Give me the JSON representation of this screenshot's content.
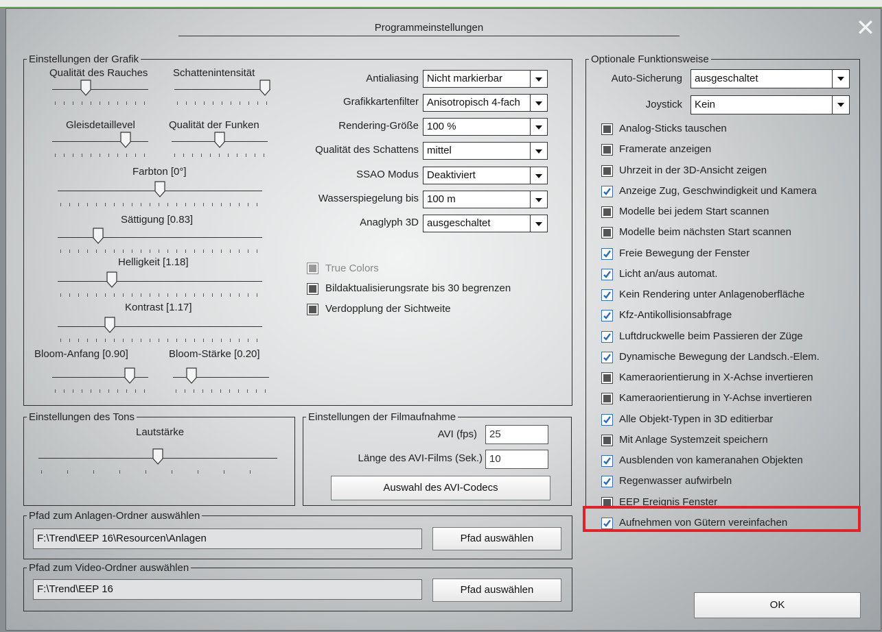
{
  "window": {
    "title": "Programmeinstellungen"
  },
  "graphics": {
    "legend": "Einstellungen der Grafik",
    "sliders": {
      "smoke": {
        "label": "Qualität des Rauches",
        "level": 0.33
      },
      "shadow": {
        "label": "Schattenintensität",
        "level": 1.0
      },
      "track_detail": {
        "label": "Gleisdetaillevel",
        "level": 0.8
      },
      "sparks": {
        "label": "Qualität der Funken",
        "level": 0.5
      },
      "hue": {
        "label": "Farbton [0°]",
        "level": 0.5
      },
      "saturation": {
        "label": "Sättigung [0.83]",
        "level": 0.18
      },
      "brightness": {
        "label": "Helligkeit [1.18]",
        "level": 0.25
      },
      "contrast": {
        "label": "Kontrast [1.17]",
        "level": 0.24
      },
      "bloom_start": {
        "label": "Bloom-Anfang [0.90]",
        "level": 0.85
      },
      "bloom_strength": {
        "label": "Bloom-Stärke [0.20]",
        "level": 0.15
      }
    },
    "combos": [
      {
        "label": "Antialiasing",
        "value": "Nicht markierbar"
      },
      {
        "label": "Grafikkartenfilter",
        "value": "Anisotropisch 4-fach"
      },
      {
        "label": "Rendering-Größe",
        "value": "100 %"
      },
      {
        "label": "Qualität des Schattens",
        "value": "mittel"
      },
      {
        "label": "SSAO Modus",
        "value": "Deaktiviert"
      },
      {
        "label": "Wasserspiegelung bis",
        "value": "100 m"
      },
      {
        "label": "Anaglyph 3D",
        "value": "ausgeschaltet"
      }
    ],
    "checks": [
      {
        "label": "True Colors",
        "state": "disabled"
      },
      {
        "label": "Bildaktualisierungsrate bis 30 begrenzen",
        "state": "off"
      },
      {
        "label": "Verdopplung der Sichtweite",
        "state": "off"
      }
    ]
  },
  "sound": {
    "legend": "Einstellungen des Tons",
    "volume_label": "Lautstärke",
    "volume_level": 0.5
  },
  "film": {
    "legend": "Einstellungen der Filmaufnahme",
    "avi_fps_label": "AVI (fps)",
    "avi_fps_value": "25",
    "avi_length_label": "Länge des AVI-Films (Sek.)",
    "avi_length_value": "10",
    "codec_button": "Auswahl des AVI-Codecs"
  },
  "layout_path": {
    "legend": "Pfad zum Anlagen-Ordner auswählen",
    "value": "F:\\Trend\\EEP 16\\Resourcen\\Anlagen",
    "button": "Pfad auswählen"
  },
  "video_path": {
    "legend": "Pfad zum Video-Ordner auswählen",
    "value": "F:\\Trend\\EEP 16",
    "button": "Pfad auswählen"
  },
  "optional": {
    "legend": "Optionale Funktionsweise",
    "autosave_label": "Auto-Sicherung",
    "autosave_value": "ausgeschaltet",
    "joystick_label": "Joystick",
    "joystick_value": "Kein",
    "checks": [
      {
        "label": "Analog-Sticks tauschen",
        "checked": false
      },
      {
        "label": "Framerate anzeigen",
        "checked": false
      },
      {
        "label": "Uhrzeit in der 3D-Ansicht zeigen",
        "checked": false
      },
      {
        "label": "Anzeige Zug, Geschwindigkeit und Kamera",
        "checked": true
      },
      {
        "label": "Modelle bei jedem Start scannen",
        "checked": false
      },
      {
        "label": "Modelle beim nächsten Start scannen",
        "checked": false
      },
      {
        "label": "Freie Bewegung der Fenster",
        "checked": true
      },
      {
        "label": "Licht an/aus automat.",
        "checked": true
      },
      {
        "label": "Kein Rendering unter Anlagenoberfläche",
        "checked": true
      },
      {
        "label": "Kfz-Antikollisionsabfrage",
        "checked": true
      },
      {
        "label": "Luftdruckwelle beim Passieren der Züge",
        "checked": true
      },
      {
        "label": "Dynamische Bewegung der Landsch.-Elem.",
        "checked": true
      },
      {
        "label": "Kameraorientierung in X-Achse invertieren",
        "checked": false
      },
      {
        "label": "Kameraorientierung in Y-Achse invertieren",
        "checked": false
      },
      {
        "label": "Alle Objekt-Typen in 3D editierbar",
        "checked": true
      },
      {
        "label": "Mit Anlage Systemzeit speichern",
        "checked": false
      },
      {
        "label": "Ausblenden von kameranahen Objekten",
        "checked": true
      },
      {
        "label": "Regenwasser aufwirbeln",
        "checked": true
      },
      {
        "label": "EEP Ereignis Fenster",
        "checked": false
      },
      {
        "label": "Aufnehmen von Gütern vereinfachen",
        "checked": true
      }
    ]
  },
  "ok_button": "OK",
  "colors": {
    "highlight": "#e0232a",
    "check_accent": "#3a6ea5"
  }
}
